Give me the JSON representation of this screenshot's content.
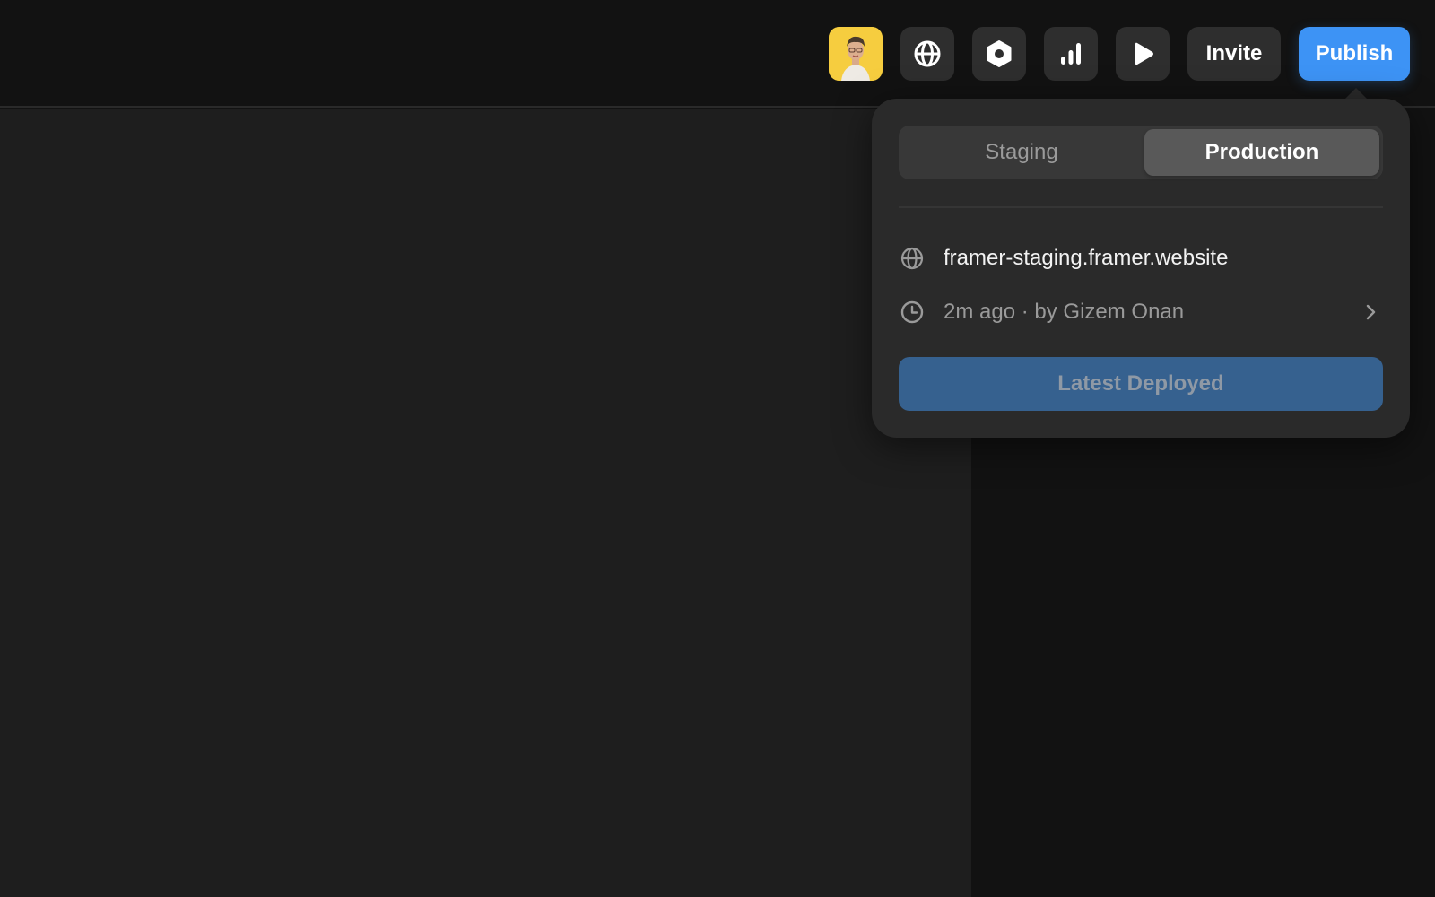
{
  "toolbar": {
    "avatar_alt": "User avatar",
    "icons": [
      "globe-icon",
      "settings-hexagon-icon",
      "analytics-bars-icon",
      "preview-play-icon"
    ],
    "invite_label": "Invite",
    "publish_label": "Publish",
    "accent_color": "#3d93f5"
  },
  "publish_popover": {
    "tabs": [
      {
        "label": "Staging",
        "selected": false
      },
      {
        "label": "Production",
        "selected": true
      }
    ],
    "domain": "framer-staging.framer.website",
    "last_published": "2m ago · by Gizem Onan",
    "deploy_button_label": "Latest Deployed",
    "deploy_button_enabled": false
  }
}
